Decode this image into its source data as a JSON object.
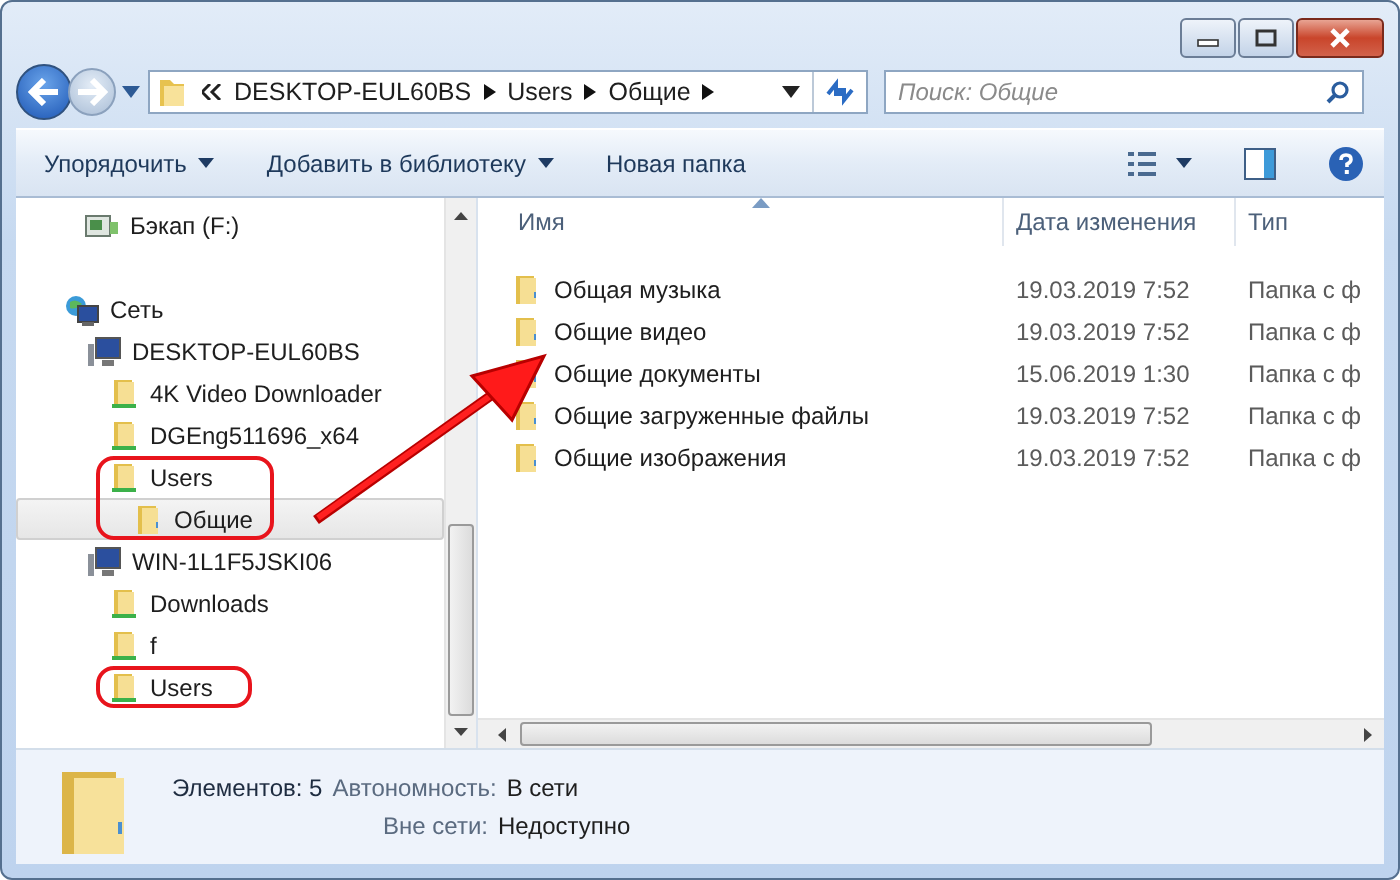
{
  "address": {
    "crumbs": [
      "DESKTOP-EUL60BS",
      "Users",
      "Общие"
    ]
  },
  "search": {
    "placeholder": "Поиск: Общие"
  },
  "toolbar": [
    {
      "label": "Упорядочить",
      "dropdown": true
    },
    {
      "label": "Добавить в библиотеку",
      "dropdown": true
    },
    {
      "label": "Новая папка",
      "dropdown": false
    }
  ],
  "tree": [
    {
      "label": "Бэкап (F:)",
      "kind": "drive",
      "selected": false
    },
    {
      "label": "Сеть",
      "kind": "network",
      "selected": false,
      "children": [
        {
          "label": "DESKTOP-EUL60BS",
          "kind": "computer",
          "selected": false,
          "children": [
            {
              "label": "4K Video Downloader",
              "kind": "share",
              "selected": false
            },
            {
              "label": "DGEng511696_x64",
              "kind": "share",
              "selected": false
            },
            {
              "label": "Users",
              "kind": "share",
              "selected": false,
              "circled": true,
              "children": [
                {
                  "label": "Общие",
                  "kind": "folder",
                  "selected": true
                }
              ]
            }
          ]
        },
        {
          "label": "WIN-1L1F5JSKI06",
          "kind": "computer",
          "selected": false,
          "children": [
            {
              "label": "Downloads",
              "kind": "share",
              "selected": false
            },
            {
              "label": "f",
              "kind": "share",
              "selected": false
            },
            {
              "label": "Users",
              "kind": "share",
              "selected": false,
              "circled": true
            }
          ]
        }
      ]
    }
  ],
  "table": {
    "columns": [
      "Имя",
      "Дата изменения",
      "Тип"
    ],
    "rows": [
      {
        "name": "Общая музыка",
        "date": "19.03.2019 7:52",
        "type": "Папка с ф"
      },
      {
        "name": "Общие видео",
        "date": "19.03.2019 7:52",
        "type": "Папка с ф"
      },
      {
        "name": "Общие документы",
        "date": "15.06.2019 1:30",
        "type": "Папка с ф"
      },
      {
        "name": "Общие загруженные файлы",
        "date": "19.03.2019 7:52",
        "type": "Папка с ф"
      },
      {
        "name": "Общие изображения",
        "date": "19.03.2019 7:52",
        "type": "Папка с ф"
      }
    ]
  },
  "details": {
    "count": "Элементов: 5",
    "fields": [
      {
        "label": "Автономность:",
        "value": "В сети"
      },
      {
        "label": "Вне сети:",
        "value": "Недоступно"
      }
    ]
  }
}
